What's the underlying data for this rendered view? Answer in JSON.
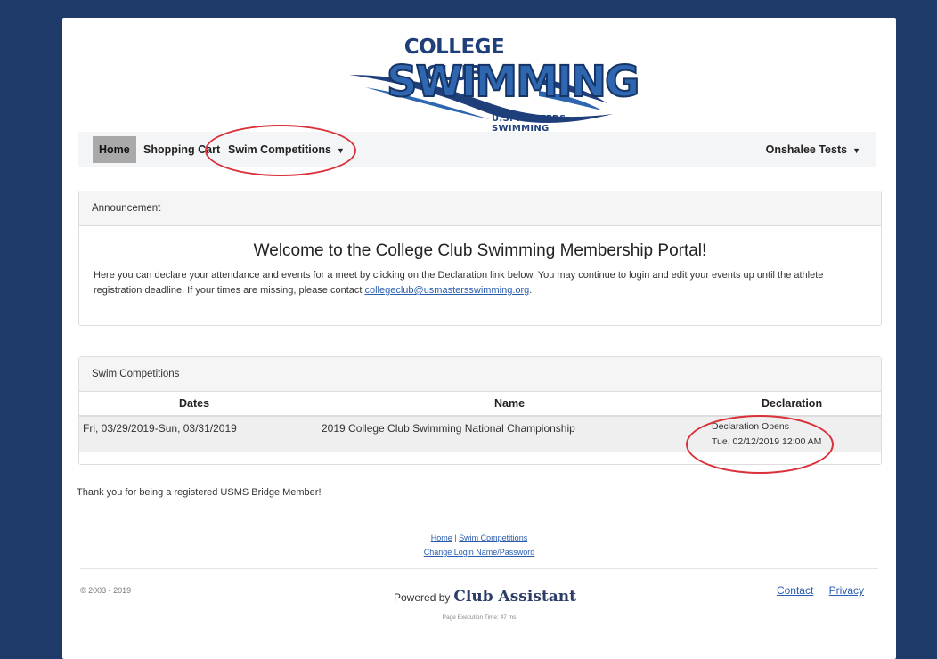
{
  "logo": {
    "top_text": "COLLEGE CLUB",
    "main_text": "SWIMMING",
    "sub_text": "U.S. MASTERS SWIMMING"
  },
  "nav": {
    "home": "Home",
    "shopping_cart": "Shopping Cart",
    "swim_competitions": "Swim Competitions",
    "user": "Onshalee Tests",
    "caret": "▼"
  },
  "announcement": {
    "heading": "Announcement",
    "title": "Welcome to the College Club Swimming Membership Portal!",
    "text_before": "Here you can declare your attendance and events for a meet by clicking on the Declaration link below.  You may continue to login and edit your events up until the athlete registration deadline.  If your times are missing, please contact ",
    "email": "collegeclub@usmastersswimming.org",
    "text_after": "."
  },
  "competitions": {
    "heading": "Swim Competitions",
    "columns": [
      "Dates",
      "Name",
      "Declaration"
    ],
    "rows": [
      {
        "dates": "Fri, 03/29/2019-Sun, 03/31/2019",
        "name": "2019 College Club Swimming National Championship",
        "declaration_status": "Declaration Opens",
        "declaration_time": "Tue, 02/12/2019 12:00 AM"
      }
    ]
  },
  "thanks": "Thank you for being a registered USMS Bridge Member!",
  "footer": {
    "home_link": "Home",
    "separator": "|",
    "swim_competitions_link": "Swim Competitions",
    "change_login_link": "Change Login Name/Password",
    "copyright": "© 2003 - 2019",
    "powered_by": "Powered by",
    "brand": "Club Assistant",
    "execution_time": "Page Execution Time: 47 ms",
    "contact": "Contact",
    "privacy": "Privacy"
  },
  "colors": {
    "background": "#1e3a68",
    "link": "#2a5db0",
    "annotation": "#d9303a"
  }
}
